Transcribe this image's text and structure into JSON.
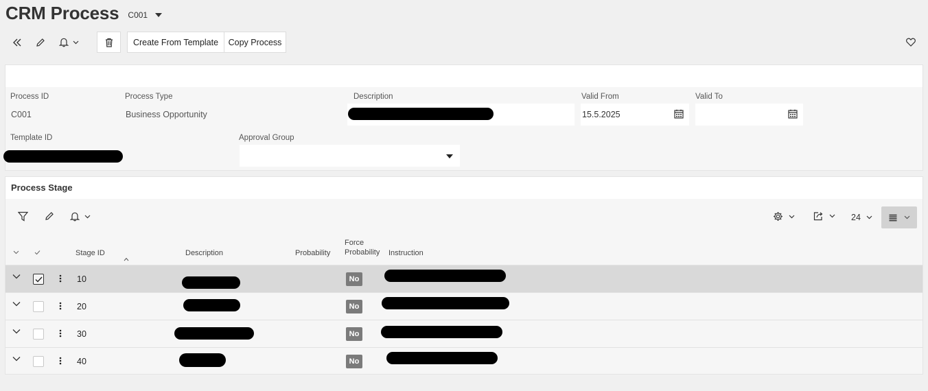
{
  "header": {
    "title": "CRM Process",
    "record_id": "C001"
  },
  "toolbar": {
    "create_from_template_label": "Create From Template",
    "copy_process_label": "Copy Process"
  },
  "form": {
    "process_id": {
      "label": "Process ID",
      "value": "C001"
    },
    "process_type": {
      "label": "Process Type",
      "value": "Business Opportunity"
    },
    "description": {
      "label": "Description",
      "value": ""
    },
    "valid_from": {
      "label": "Valid From",
      "value": "15.5.2025"
    },
    "valid_to": {
      "label": "Valid To",
      "value": ""
    },
    "template_id": {
      "label": "Template ID",
      "value": ""
    },
    "approval_group": {
      "label": "Approval Group",
      "value": ""
    }
  },
  "stage": {
    "title": "Process Stage",
    "page_size": "24",
    "columns": {
      "stage_id": "Stage ID",
      "description": "Description",
      "probability": "Probability",
      "force_probability_1": "Force",
      "force_probability_2": "Probability",
      "instruction": "Instruction"
    },
    "rows": [
      {
        "stage_id": "10",
        "force_probability": "No",
        "selected": true
      },
      {
        "stage_id": "20",
        "force_probability": "No",
        "selected": false
      },
      {
        "stage_id": "30",
        "force_probability": "No",
        "selected": false
      },
      {
        "stage_id": "40",
        "force_probability": "No",
        "selected": false
      }
    ]
  }
}
